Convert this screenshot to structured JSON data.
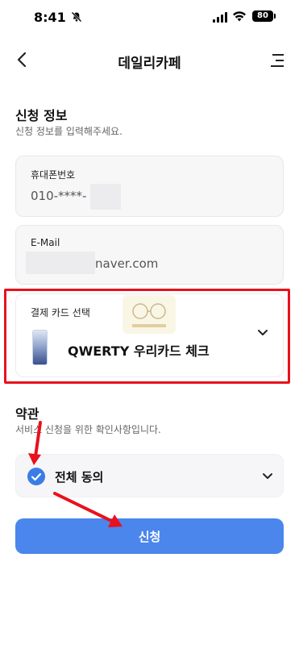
{
  "status_bar": {
    "time": "8:41",
    "battery": "80"
  },
  "header": {
    "title": "데일리카페"
  },
  "application": {
    "title": "신청 정보",
    "subtitle": "신청 정보를 입력해주세요.",
    "phone": {
      "label": "휴대폰번호",
      "value": "010-****-"
    },
    "email": {
      "label": "E-Mail",
      "value": "naver.com"
    },
    "card": {
      "label": "결제 카드 선택",
      "value": "QWERTY 우리카드 체크"
    }
  },
  "terms": {
    "title": "약관",
    "subtitle": "서비스 신청을 위한 확인사항입니다.",
    "agree_all": "전체 동의"
  },
  "submit_label": "신청",
  "annotations": {
    "highlight_color": "#e8111c",
    "arrow_color": "#e8111c"
  }
}
